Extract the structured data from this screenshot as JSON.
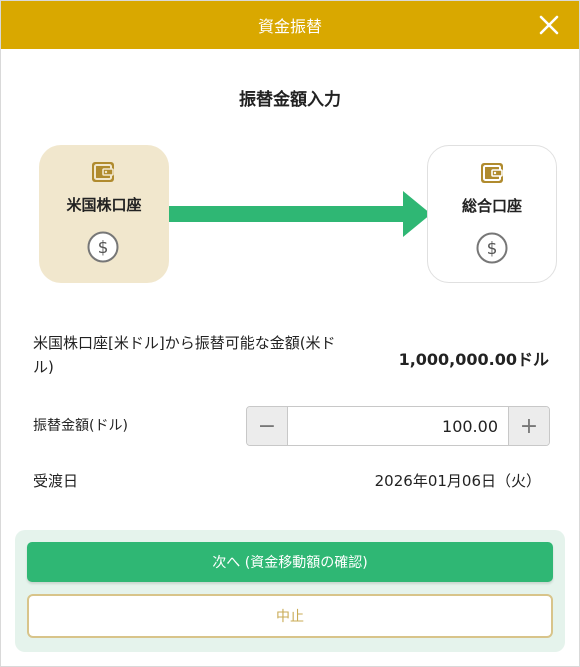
{
  "header": {
    "title": "資金振替"
  },
  "subtitle": "振替金額入力",
  "from_account": {
    "label": "米国株口座"
  },
  "to_account": {
    "label": "総合口座"
  },
  "available": {
    "label": "米国株口座[米ドル]から振替可能な金額(米ドル)",
    "value": "1,000,000.00ドル"
  },
  "transfer_amount": {
    "label": "振替金額(ドル)",
    "value": "100.00",
    "minus": "−",
    "plus": "+"
  },
  "delivery_date": {
    "label": "受渡日",
    "value": "2026年01月06日（火）"
  },
  "buttons": {
    "next": "次へ (資金移動額の確認)",
    "cancel": "中止"
  },
  "colors": {
    "header": "#d9a800",
    "accent_green": "#2fb774",
    "from_card": "#f1e7cd",
    "icon_gold": "#b08b2e"
  }
}
